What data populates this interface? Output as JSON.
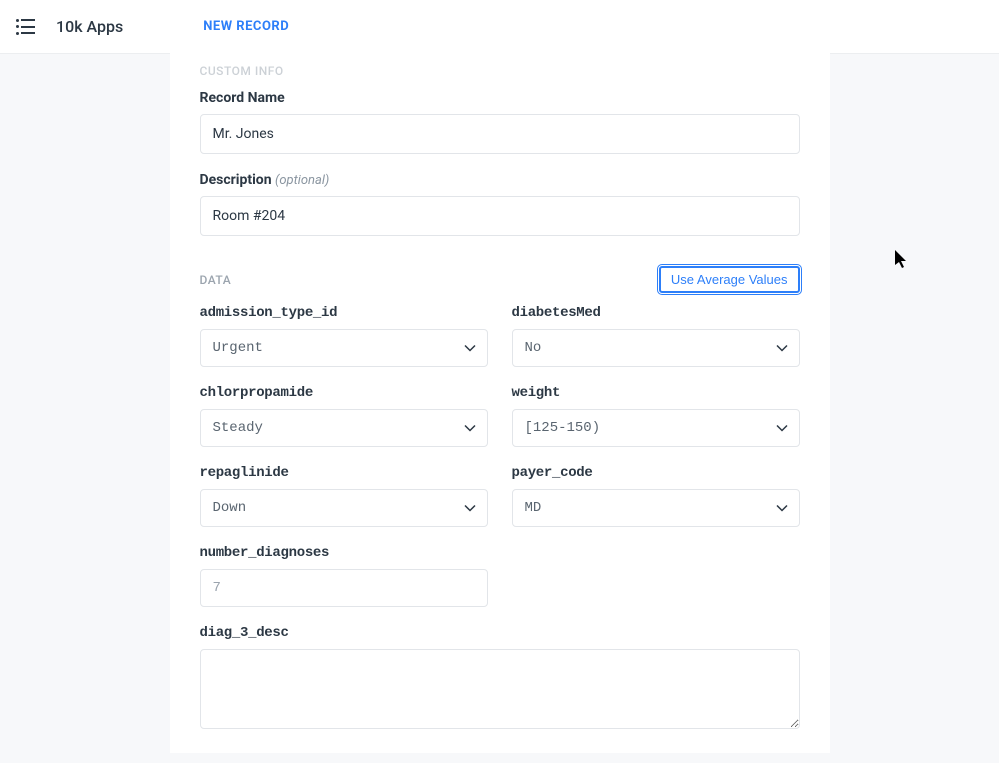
{
  "header": {
    "app_title": "10k Apps",
    "page_title": "NEW RECORD"
  },
  "sections": {
    "custom_info": "CUSTOM INFO",
    "data": "DATA"
  },
  "custom_info": {
    "record_name_label": "Record Name",
    "record_name_value": "Mr. Jones",
    "description_label": "Description ",
    "description_optional": "(optional)",
    "description_value": "Room #204"
  },
  "actions": {
    "use_avg": "Use Average Values"
  },
  "data_fields": {
    "admission_type_id": {
      "label": "admission_type_id",
      "value": "Urgent"
    },
    "diabetesMed": {
      "label": "diabetesMed",
      "value": "No"
    },
    "chlorpropamide": {
      "label": "chlorpropamide",
      "value": "Steady"
    },
    "weight": {
      "label": "weight",
      "value": "[125-150)"
    },
    "repaglinide": {
      "label": "repaglinide",
      "value": "Down"
    },
    "payer_code": {
      "label": "payer_code",
      "value": "MD"
    },
    "number_diagnoses": {
      "label": "number_diagnoses",
      "value": "7"
    },
    "diag_3_desc": {
      "label": "diag_3_desc",
      "value": ""
    }
  }
}
